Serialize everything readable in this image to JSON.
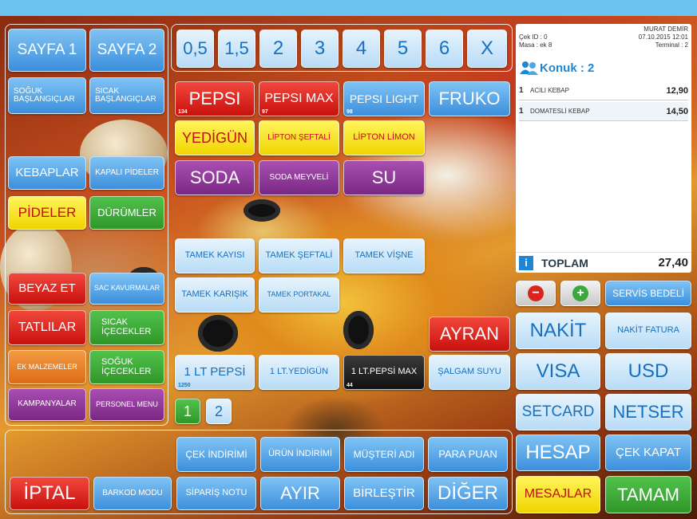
{
  "categories": [
    {
      "label": "SAYFA 1",
      "color": "blue"
    },
    {
      "label": "SAYFA 2",
      "color": "blue"
    },
    {
      "label": "SOĞUK BAŞLANGIÇLAR",
      "color": "blue"
    },
    {
      "label": "SICAK BAŞLANGIÇLAR",
      "color": "blue"
    },
    {
      "label": "KEBAPLAR",
      "color": "blue"
    },
    {
      "label": "KAPALI PİDELER",
      "color": "blue"
    },
    {
      "label": "PİDELER",
      "color": "yellow"
    },
    {
      "label": "DÜRÜMLER",
      "color": "green"
    },
    {
      "label": "BEYAZ ET",
      "color": "red"
    },
    {
      "label": "SAC KAVURMALAR",
      "color": "blue"
    },
    {
      "label": "TATLILAR",
      "color": "red"
    },
    {
      "label": "SICAK İÇECEKLER",
      "color": "green"
    },
    {
      "label": "EK MALZEMELER",
      "color": "orange"
    },
    {
      "label": "SOĞUK İÇECEKLER",
      "color": "green"
    },
    {
      "label": "KAMPANYALAR",
      "color": "purple"
    },
    {
      "label": "PERSONEL MENU",
      "color": "purple"
    }
  ],
  "quantities": [
    "0,5",
    "1,5",
    "2",
    "3",
    "4",
    "5",
    "6",
    "X"
  ],
  "products": [
    {
      "label": "PEPSI",
      "badge": "134"
    },
    {
      "label": "PEPSI MAX",
      "badge": "97"
    },
    {
      "label": "PEPSI LIGHT",
      "badge": "98"
    },
    {
      "label": "FRUKO",
      "badge": ""
    },
    {
      "label": "YEDİGÜN",
      "badge": ""
    },
    {
      "label": "LİPTON ŞEFTALİ",
      "badge": ""
    },
    {
      "label": "LİPTON LİMON",
      "badge": ""
    },
    {
      "label": "SODA",
      "badge": ""
    },
    {
      "label": "SODA MEYVELİ",
      "badge": ""
    },
    {
      "label": "SU",
      "badge": ""
    },
    {
      "label": "TAMEK KAYISI",
      "badge": ""
    },
    {
      "label": "TAMEK ŞEFTALİ",
      "badge": ""
    },
    {
      "label": "TAMEK VİŞNE",
      "badge": ""
    },
    {
      "label": "TAMEK KARIŞIK",
      "badge": ""
    },
    {
      "label": "TAMEK PORTAKAL",
      "badge": ""
    },
    {
      "label": "AYRAN",
      "badge": ""
    },
    {
      "label": "1 LT PEPSİ",
      "badge": "1250"
    },
    {
      "label": "1 LT.YEDİGÜN",
      "badge": ""
    },
    {
      "label": "1 LT.PEPSİ MAX",
      "badge": "44"
    },
    {
      "label": "ŞALGAM SUYU",
      "badge": ""
    }
  ],
  "pages": [
    "1",
    "2"
  ],
  "receipt": {
    "check_id": "Çek ID : 0",
    "table": "Masa : ek 8",
    "waiter": "MURAT DEMİR",
    "datetime": "07.10.2015 12:01",
    "terminal": "Terminal : 2",
    "guests": "Konuk : 2",
    "items": [
      {
        "qty": "1",
        "name": "ACILI KEBAP",
        "price": "12,90"
      },
      {
        "qty": "1",
        "name": "DOMATESLİ KEBAP",
        "price": "14,50"
      }
    ],
    "total_label": "TOPLAM",
    "total": "27,40",
    "info_icon": "i"
  },
  "right_buttons": {
    "minus": "−",
    "plus": "+",
    "service": "SERVİS BEDELİ",
    "cash": "NAKİT",
    "cash_invoice": "NAKİT FATURA",
    "visa": "VISA",
    "usd": "USD",
    "setcard": "SETCARD",
    "netser": "NETSER",
    "bill": "HESAP",
    "close_check": "ÇEK KAPAT",
    "messages": "MESAJLAR",
    "ok": "TAMAM"
  },
  "bottom_buttons": {
    "check_discount": "ÇEK İNDİRİMİ",
    "product_discount": "ÜRÜN İNDİRİMİ",
    "customer_name": "MÜŞTERİ ADI",
    "points": "PARA PUAN",
    "cancel": "İPTAL",
    "barcode": "BARKOD MODU",
    "order_note": "SİPARİŞ NOTU",
    "split": "AYIR",
    "merge": "BİRLEŞTİR",
    "other": "DİĞER"
  },
  "colors": {
    "accent": "#3c8fdc",
    "header_bar": "#6cc3f0"
  }
}
